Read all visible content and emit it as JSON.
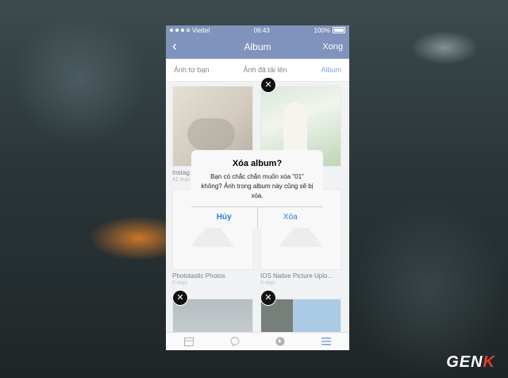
{
  "status": {
    "carrier": "Viettel",
    "time": "06:43",
    "battery": "100%"
  },
  "nav": {
    "back_icon": "chevron-left-icon",
    "title": "Album",
    "done_label": "Xong"
  },
  "tabs": [
    "Ảnh từ bạn",
    "Ảnh đã tải lên",
    "Album"
  ],
  "albums": [
    {
      "name": "Instag",
      "count": "41 mục"
    },
    {
      "name": "",
      "count": ""
    },
    {
      "name": "",
      "count": ""
    },
    {
      "name": "",
      "count": ""
    },
    {
      "name": "Phototastic Photos",
      "count": "0 mục"
    },
    {
      "name": "IOS Native Picture Uplo...",
      "count": "0 mục"
    }
  ],
  "dialog": {
    "title": "Xóa album?",
    "message": "Bạn có chắc chắn muốn xóa \"01\" không? Ảnh trong album này cũng sẽ bị xóa.",
    "cancel": "Hủy",
    "confirm": "Xóa"
  },
  "toolbar_icons": [
    "news-feed-icon",
    "messenger-icon",
    "globe-icon",
    "menu-icon"
  ],
  "watermark": {
    "text_main": "GEN",
    "text_accent": "K"
  },
  "colors": {
    "facebook_blue": "#3b5998",
    "ios_blue": "#2f7be0"
  }
}
